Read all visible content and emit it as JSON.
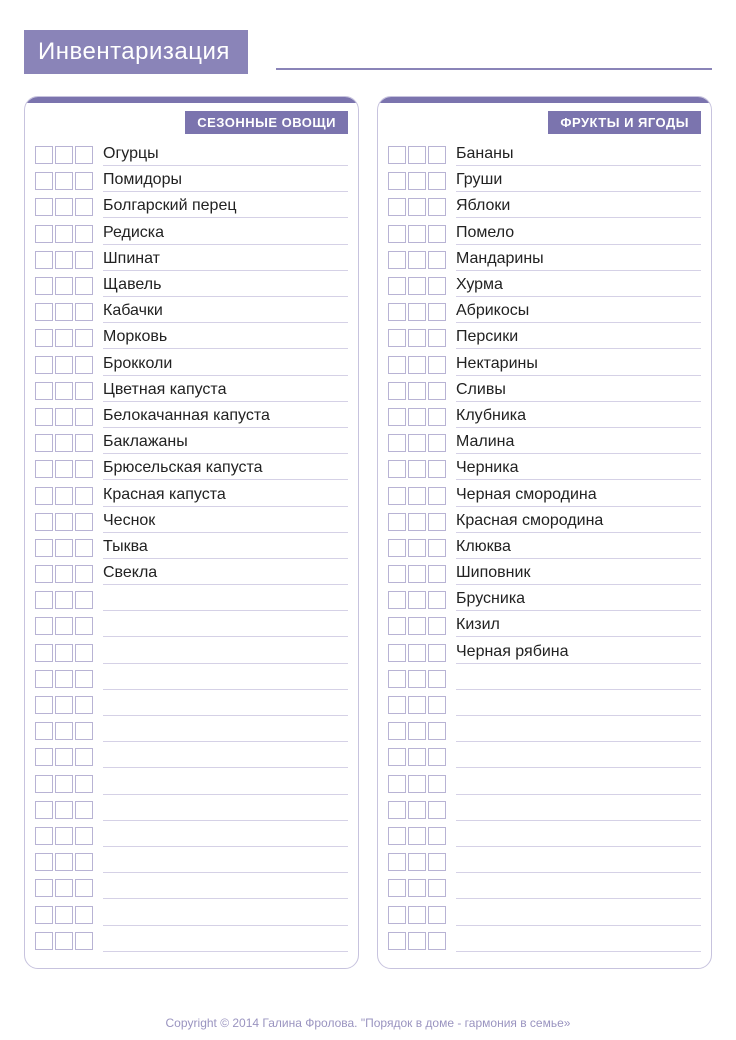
{
  "title": "Инвентаризация",
  "total_rows": 31,
  "columns": [
    {
      "header": "СЕЗОННЫЕ ОВОЩИ",
      "items": [
        "Огурцы",
        "Помидоры",
        "Болгарский перец",
        "Редиска",
        "Шпинат",
        "Щавель",
        "Кабачки",
        "Морковь",
        "Брокколи",
        "Цветная капуста",
        "Белокачанная капуста",
        "Баклажаны",
        "Брюсельская капуста",
        "Красная капуста",
        "Чеснок",
        "Тыква",
        "Свекла"
      ]
    },
    {
      "header": "ФРУКТЫ И ЯГОДЫ",
      "items": [
        "Бананы",
        "Груши",
        "Яблоки",
        "Помело",
        "Мандарины",
        "Хурма",
        "Абрикосы",
        "Персики",
        "Нектарины",
        "Сливы",
        "Клубника",
        "Малина",
        "Черника",
        "Черная смородина",
        "Красная смородина",
        "Клюква",
        "Шиповник",
        "Брусника",
        "Кизил",
        "Черная рябина"
      ]
    }
  ],
  "footer": "Copyright © 2014 Галина Фролова. \"Порядок в доме - гармония в семье»"
}
